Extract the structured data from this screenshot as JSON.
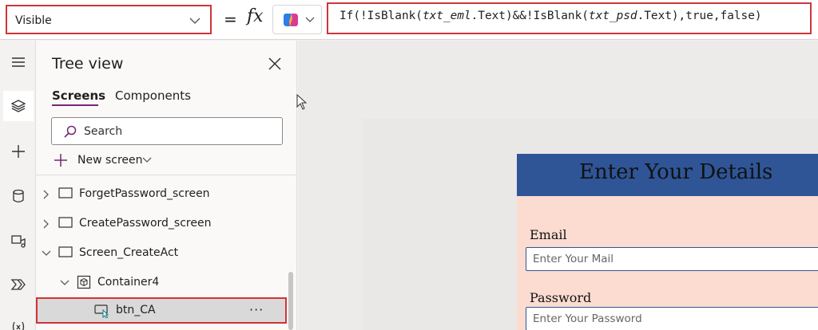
{
  "formula_bar": {
    "property": "Visible",
    "equals": "=",
    "fx": "fx",
    "formula": {
      "p1": "If(!IsBlank(",
      "id1": "txt_eml",
      "p2": ".Text)&&!IsBlank(",
      "id2": "txt_psd",
      "p3": ".Text),true,false)"
    }
  },
  "rail": {
    "icons": [
      "hamburger-icon",
      "layers-icon",
      "plus-icon",
      "database-icon",
      "media-icon",
      "power-automate-icon",
      "variables-icon"
    ]
  },
  "tree_view": {
    "title": "Tree view",
    "tabs": [
      "Screens",
      "Components"
    ],
    "search_placeholder": "Search",
    "new_screen_label": "New screen",
    "nodes": [
      {
        "name": "ForgetPassword_screen",
        "kind": "screen",
        "expanded": false
      },
      {
        "name": "CreatePassword_screen",
        "kind": "screen",
        "expanded": false
      },
      {
        "name": "Screen_CreateAct",
        "kind": "screen",
        "expanded": true
      },
      {
        "name": "Container4",
        "kind": "container",
        "expanded": true
      },
      {
        "name": "btn_CA",
        "kind": "button",
        "selected": true
      }
    ],
    "more_label": "···"
  },
  "canvas": {
    "form_title": "Enter Your Details",
    "email_label": "Email",
    "email_placeholder": "Enter Your Mail",
    "password_label": "Password",
    "password_placeholder": "Enter Your Password"
  },
  "colors": {
    "highlight_red": "#d13438",
    "header_blue": "#2f5597",
    "form_background": "#fcdcd1",
    "tab_underline": "#742774"
  }
}
